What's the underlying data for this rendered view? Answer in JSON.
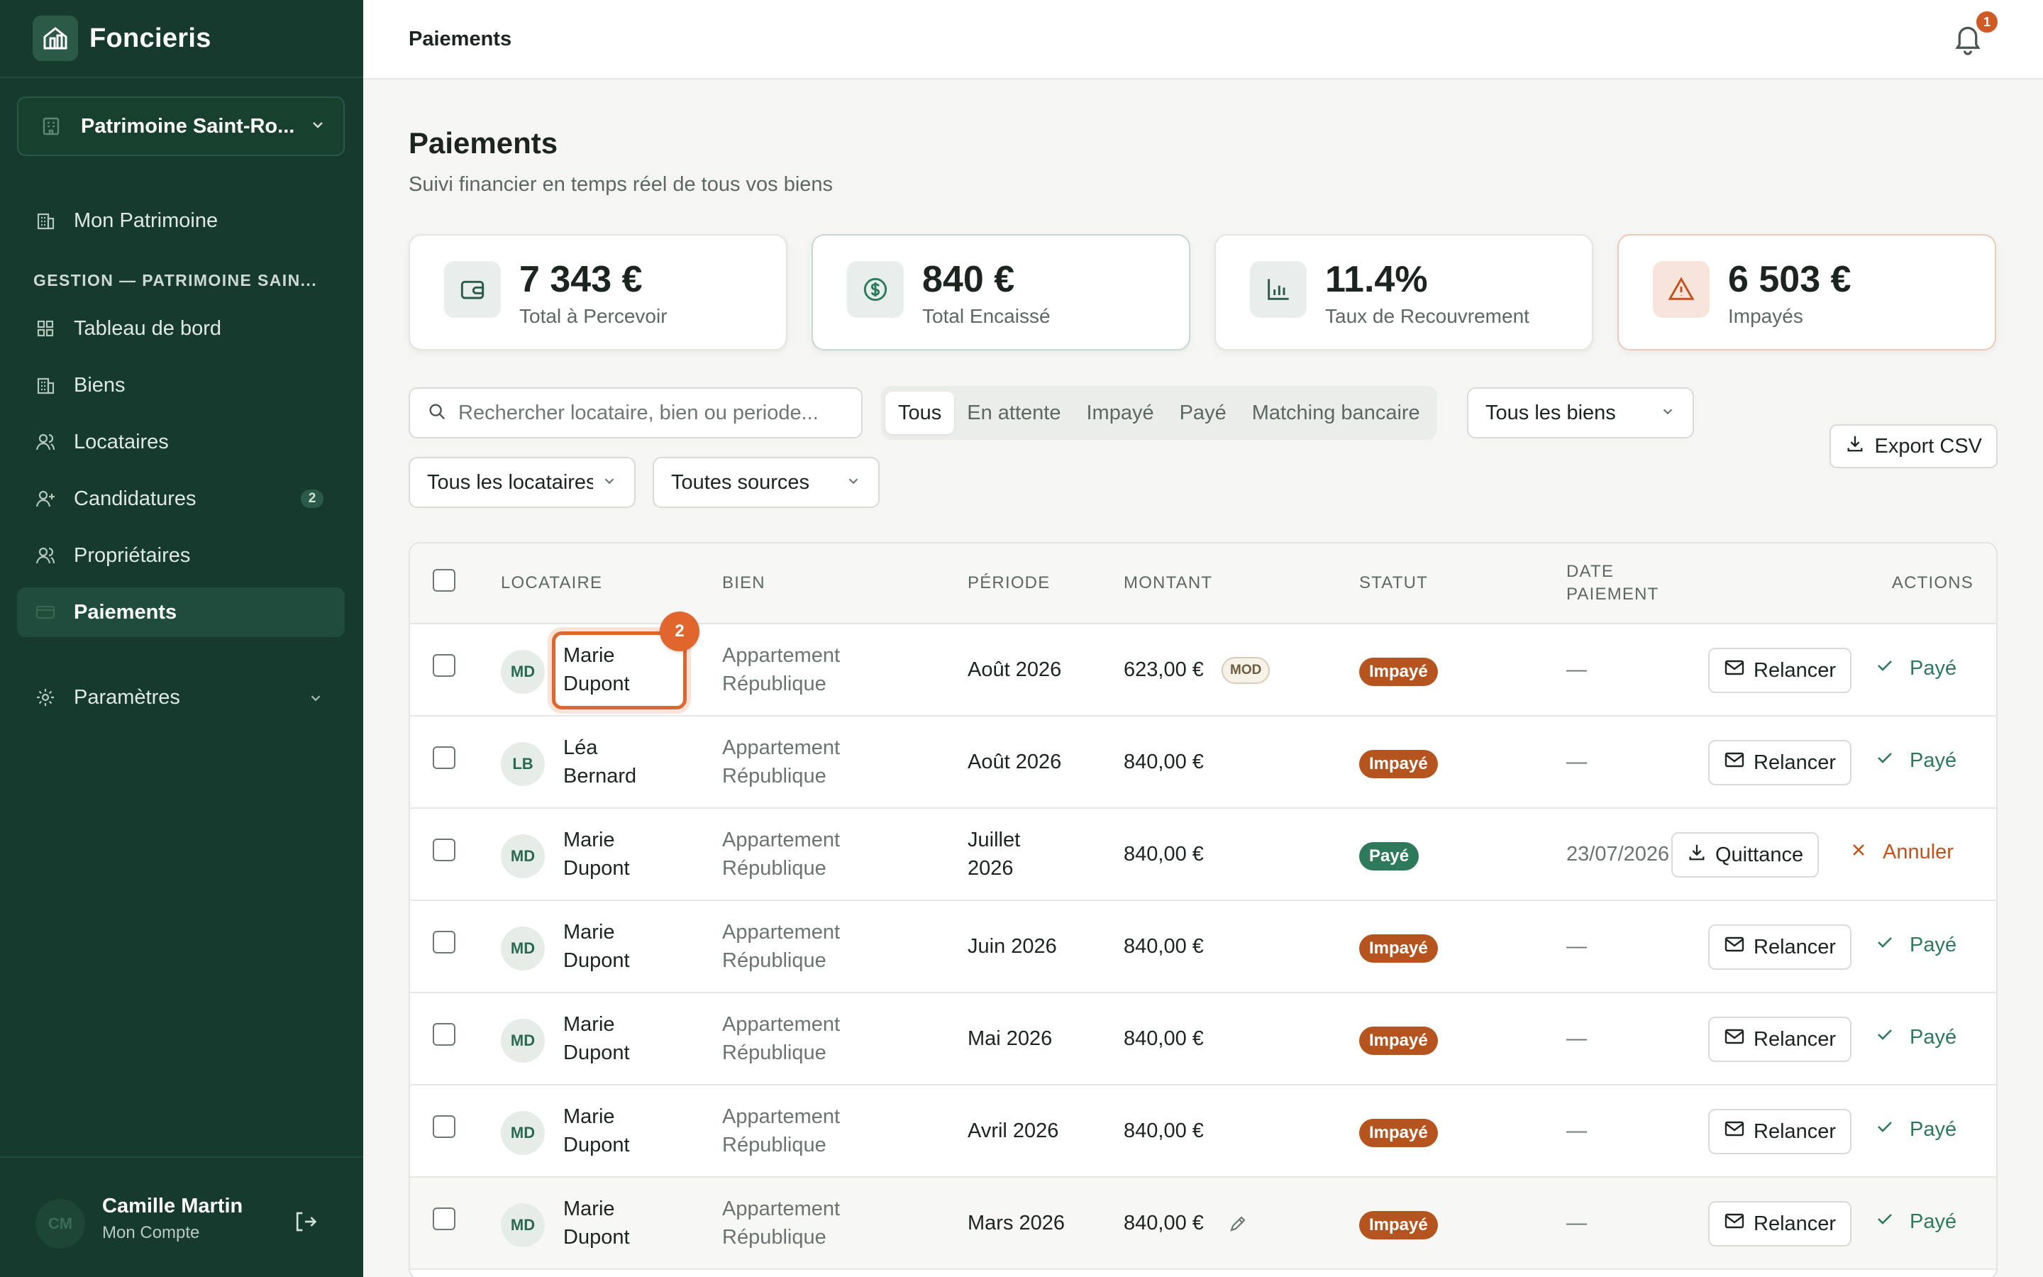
{
  "brand": {
    "name": "Foncieris"
  },
  "workspace": {
    "name": "Patrimoine Saint-Ro..."
  },
  "nav": {
    "patrimoine": "Mon Patrimoine",
    "section": "GESTION — PATRIMOINE SAIN...",
    "items": [
      {
        "label": "Tableau de bord",
        "icon": "dashboard-icon"
      },
      {
        "label": "Biens",
        "icon": "building-icon"
      },
      {
        "label": "Locataires",
        "icon": "users-icon"
      },
      {
        "label": "Candidatures",
        "icon": "user-plus-icon",
        "badge": "2"
      },
      {
        "label": "Propriétaires",
        "icon": "owner-icon"
      },
      {
        "label": "Paiements",
        "icon": "card-icon",
        "active": true
      }
    ],
    "settings": "Paramètres"
  },
  "user": {
    "initials": "CM",
    "name": "Camille Martin",
    "sub": "Mon Compte"
  },
  "topbar": {
    "title": "Paiements",
    "notifications": "1"
  },
  "page": {
    "title": "Paiements",
    "subtitle": "Suivi financier en temps réel de tous vos biens"
  },
  "kpis": [
    {
      "value": "7 343 €",
      "label": "Total à Percevoir"
    },
    {
      "value": "840 €",
      "label": "Total Encaissé"
    },
    {
      "value": "11.4%",
      "label": "Taux de Recouvrement"
    },
    {
      "value": "6 503 €",
      "label": "Impayés"
    }
  ],
  "filters": {
    "search_placeholder": "Rechercher locataire, bien ou periode...",
    "tabs": [
      "Tous",
      "En attente",
      "Impayé",
      "Payé",
      "Matching bancaire"
    ],
    "active_tab": "Tous",
    "biens": "Tous les biens",
    "locataires": "Tous les locataires",
    "sources": "Toutes sources",
    "export": "Export CSV"
  },
  "table": {
    "headers": {
      "locataire": "LOCATAIRE",
      "bien": "BIEN",
      "periode": "PÉRIODE",
      "montant": "MONTANT",
      "statut": "STATUT",
      "date_1": "DATE",
      "date_2": "PAIEMENT",
      "actions": "ACTIONS"
    },
    "rows": [
      {
        "initials": "MD",
        "first": "Marie",
        "last": "Dupont",
        "bien1": "Appartement",
        "bien2": "République",
        "periode": "Août 2026",
        "montant": "623,00 €",
        "chip": "MOD",
        "statut": "Impayé",
        "date": "—",
        "action": "Relancer",
        "link": "Payé"
      },
      {
        "initials": "LB",
        "first": "Léa",
        "last": "Bernard",
        "bien1": "Appartement",
        "bien2": "République",
        "periode": "Août 2026",
        "montant": "840,00 €",
        "statut": "Impayé",
        "date": "—",
        "action": "Relancer",
        "link": "Payé"
      },
      {
        "initials": "MD",
        "first": "Marie",
        "last": "Dupont",
        "bien1": "Appartement",
        "bien2": "République",
        "periode1": "Juillet",
        "periode2": "2026",
        "montant": "840,00 €",
        "statut": "Payé",
        "date": "23/07/2026",
        "action": "Quittance",
        "link": "Annuler"
      },
      {
        "initials": "MD",
        "first": "Marie",
        "last": "Dupont",
        "bien1": "Appartement",
        "bien2": "République",
        "periode": "Juin 2026",
        "montant": "840,00 €",
        "statut": "Impayé",
        "date": "—",
        "action": "Relancer",
        "link": "Payé"
      },
      {
        "initials": "MD",
        "first": "Marie",
        "last": "Dupont",
        "bien1": "Appartement",
        "bien2": "République",
        "periode": "Mai 2026",
        "montant": "840,00 €",
        "statut": "Impayé",
        "date": "—",
        "action": "Relancer",
        "link": "Payé"
      },
      {
        "initials": "MD",
        "first": "Marie",
        "last": "Dupont",
        "bien1": "Appartement",
        "bien2": "République",
        "periode": "Avril 2026",
        "montant": "840,00 €",
        "statut": "Impayé",
        "date": "—",
        "action": "Relancer",
        "link": "Payé"
      },
      {
        "initials": "MD",
        "first": "Marie",
        "last": "Dupont",
        "bien1": "Appartement",
        "bien2": "République",
        "periode": "Mars 2026",
        "montant": "840,00 €",
        "statut": "Impayé",
        "date": "—",
        "action": "Relancer",
        "link": "Payé"
      }
    ]
  },
  "highlight": {
    "badge": "2"
  },
  "colors": {
    "sidebar": "#163a2e",
    "accent": "#2d7a5a",
    "impaye": "#b5541f",
    "highlight": "#e0662e"
  }
}
